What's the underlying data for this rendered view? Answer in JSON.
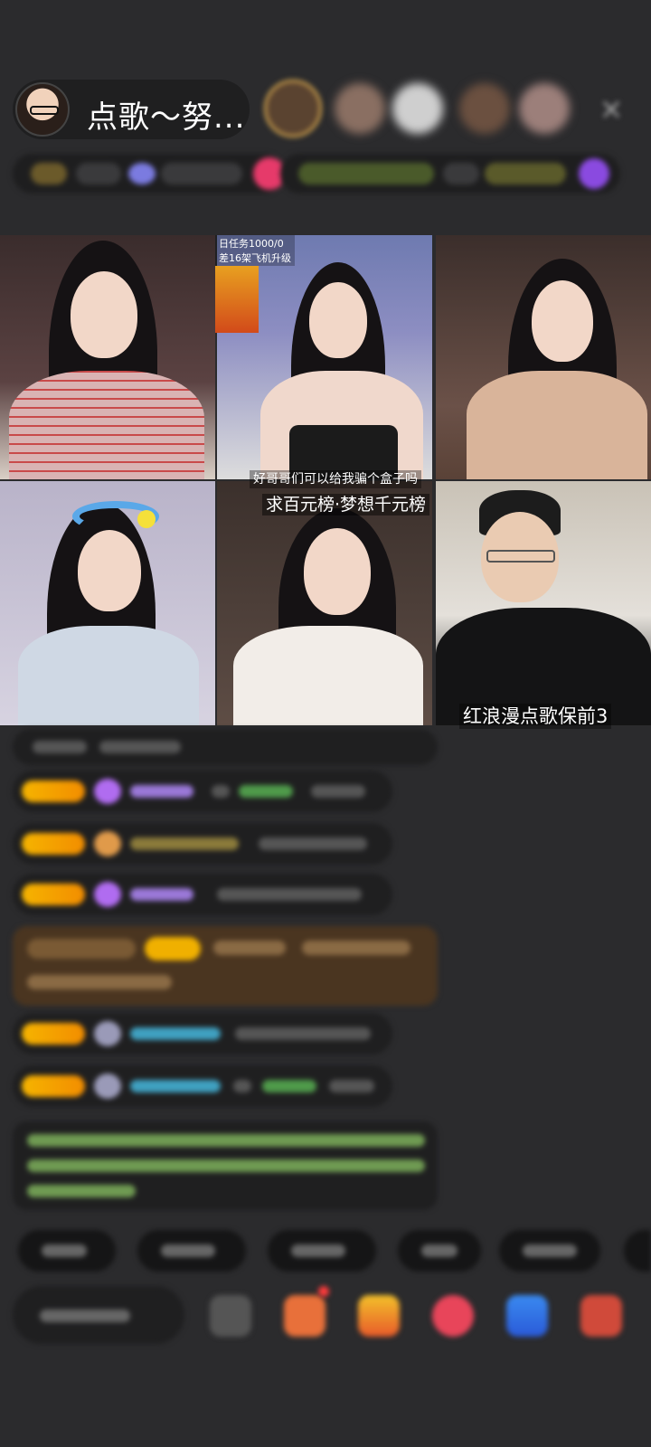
{
  "header": {
    "host_title": "点歌～努...",
    "close_icon": "×"
  },
  "stream_tiles": {
    "task_line1": "日任务1000/0",
    "task_line2": "差16架飞机升级",
    "caption_top_center": "好哥哥们可以给我骗个盒子吗",
    "caption_mid_center": "求百元榜·梦想千元榜",
    "caption_bottom_right": "红浪漫点歌保前3"
  },
  "colors": {
    "background": "#2b2b2d",
    "panel": "#1f1f20",
    "badge_gold": "#f6b400",
    "highlight_brown": "#4a3520",
    "notice_green": "#8fd46a",
    "name_purple": "#b28cff",
    "name_cyan": "#3fb6d6"
  },
  "icons": {
    "close": "close-icon",
    "heart": "heart-icon",
    "gift": "gift-icon"
  }
}
